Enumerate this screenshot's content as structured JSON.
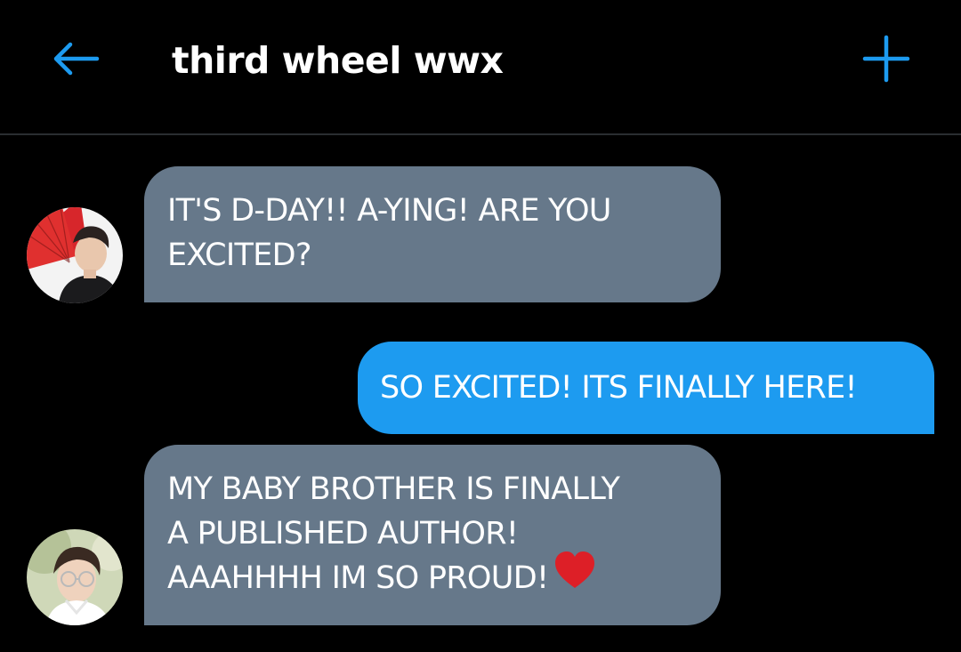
{
  "header": {
    "back_icon": "arrow-left-icon",
    "title": "third wheel wwx",
    "add_icon": "plus-icon",
    "accent_color": "#1d9bf0"
  },
  "messages": [
    {
      "direction": "received",
      "avatar": "contact-avatar-red-fan",
      "lines": [
        "IT'S D-DAY!! A-YING! ARE YOU",
        "EXCITED?"
      ]
    },
    {
      "direction": "sent",
      "lines": [
        "SO EXCITED! ITS FINALLY HERE!"
      ]
    },
    {
      "direction": "received",
      "avatar": "contact-avatar-white-shirt",
      "lines": [
        "MY BABY BROTHER IS FINALLY",
        "A PUBLISHED AUTHOR!",
        "AAAHHHH IM SO PROUD!"
      ],
      "emoji": "red-heart-icon"
    }
  ],
  "colors": {
    "background": "#000000",
    "received_bubble": "#66788a",
    "sent_bubble": "#1d9bf0",
    "divider": "#2a2d31"
  }
}
